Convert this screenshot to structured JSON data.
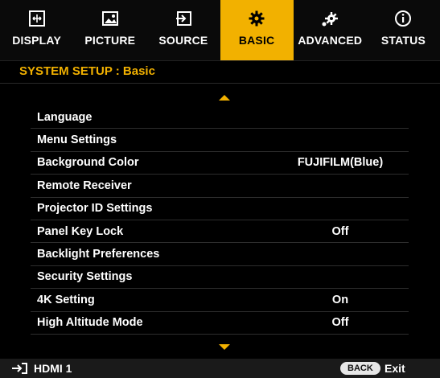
{
  "tabs": [
    {
      "label": "DISPLAY",
      "icon": "display-icon",
      "active": false
    },
    {
      "label": "PICTURE",
      "icon": "picture-icon",
      "active": false
    },
    {
      "label": "SOURCE",
      "icon": "source-icon",
      "active": false
    },
    {
      "label": "BASIC",
      "icon": "gear-icon",
      "active": true
    },
    {
      "label": "ADVANCED",
      "icon": "advanced-gear-icon",
      "active": false
    },
    {
      "label": "STATUS",
      "icon": "info-icon",
      "active": false
    }
  ],
  "panel": {
    "title": "SYSTEM SETUP : Basic"
  },
  "menu": {
    "items": [
      {
        "label": "Language",
        "value": ""
      },
      {
        "label": "Menu Settings",
        "value": ""
      },
      {
        "label": "Background Color",
        "value": "FUJIFILM(Blue)"
      },
      {
        "label": "Remote Receiver",
        "value": ""
      },
      {
        "label": "Projector ID Settings",
        "value": ""
      },
      {
        "label": "Panel Key Lock",
        "value": "Off"
      },
      {
        "label": "Backlight Preferences",
        "value": ""
      },
      {
        "label": "Security Settings",
        "value": ""
      },
      {
        "label": "4K Setting",
        "value": "On"
      },
      {
        "label": "High Altitude Mode",
        "value": "Off"
      }
    ]
  },
  "footer": {
    "source": "HDMI 1",
    "back_label": "BACK",
    "exit_label": "Exit"
  },
  "colors": {
    "accent": "#f2b100",
    "background": "#000000"
  }
}
